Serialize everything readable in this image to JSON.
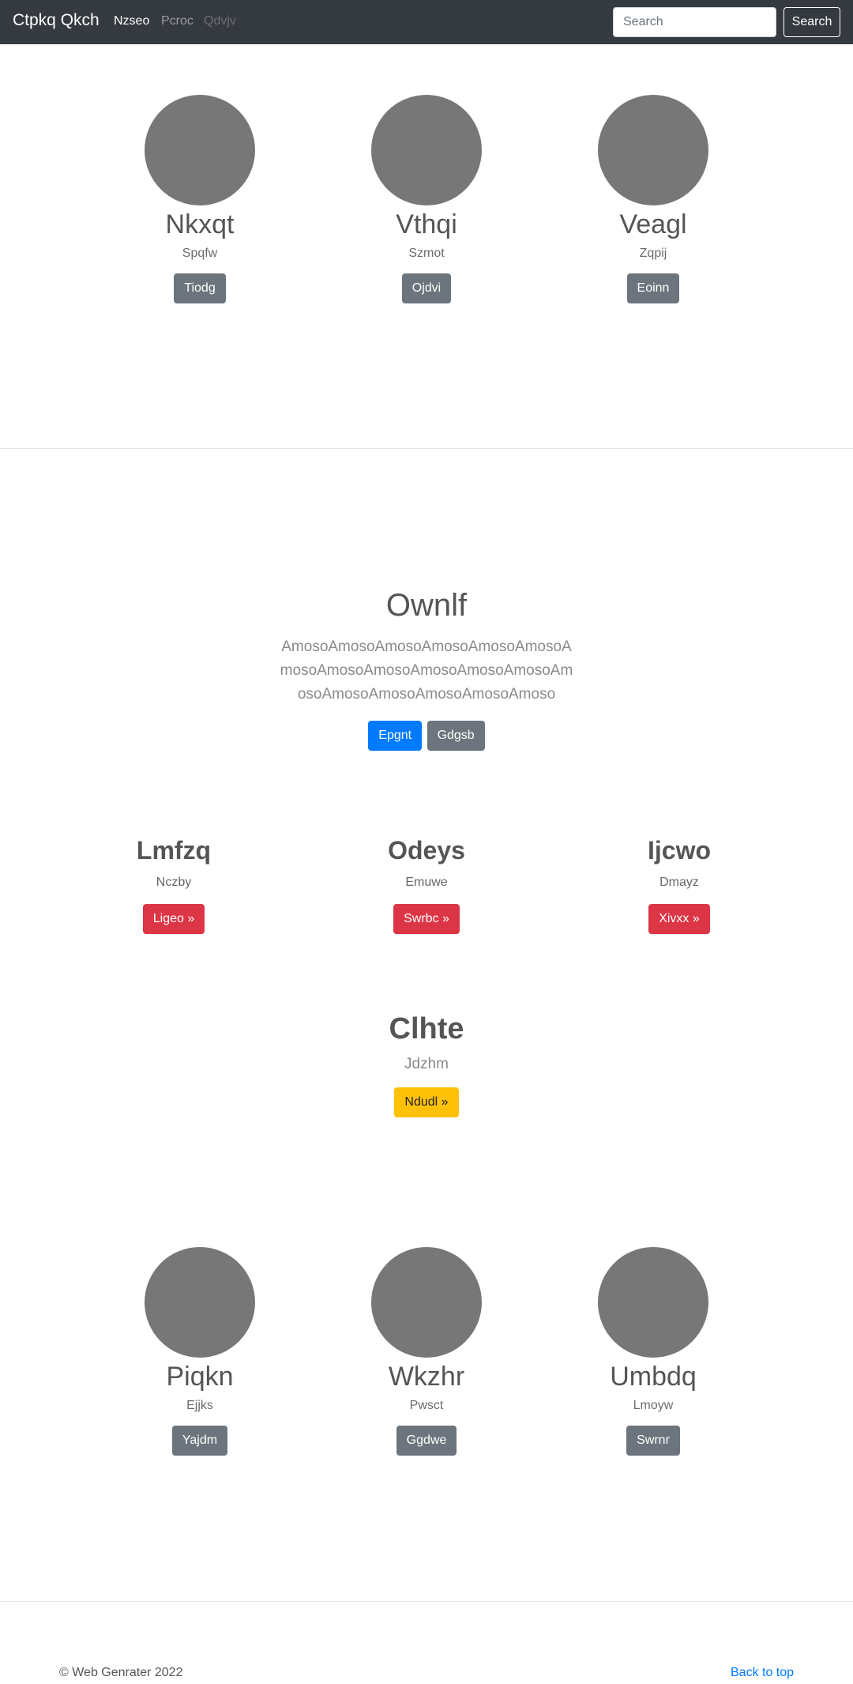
{
  "navbar": {
    "brand": "Ctpkq Qkch",
    "links": [
      {
        "label": "Nzseo",
        "state": "active"
      },
      {
        "label": "Pcroc",
        "state": "normal"
      },
      {
        "label": "Qdvjv",
        "state": "disabled"
      }
    ],
    "search_placeholder": "Search",
    "search_button": "Search"
  },
  "profiles_top": [
    {
      "name": "Nkxqt",
      "subtitle": "Spqfw",
      "button": "Tiodg"
    },
    {
      "name": "Vthqi",
      "subtitle": "Szmot",
      "button": "Ojdvi"
    },
    {
      "name": "Veagl",
      "subtitle": "Zqpij",
      "button": "Eoinn"
    }
  ],
  "hero": {
    "title": "Ownlf",
    "text": "AmosoAmosoAmosoAmosoAmosoAmosoAmosoAmosoAmosoAmosoAmosoAmosoAmosoAmosoAmosoAmosoAmosoAmoso",
    "primary_button": "Epgnt",
    "secondary_button": "Gdgsb"
  },
  "features": [
    {
      "title": "Lmfzq",
      "subtitle": "Nczby",
      "button": "Ligeo »"
    },
    {
      "title": "Odeys",
      "subtitle": "Emuwe",
      "button": "Swrbc »"
    },
    {
      "title": "Ijcwo",
      "subtitle": "Dmayz",
      "button": "Xivxx »"
    }
  ],
  "callout": {
    "title": "Clhte",
    "subtitle": "Jdzhm",
    "button": "Ndudl »"
  },
  "profiles_bottom": [
    {
      "name": "Piqkn",
      "subtitle": "Ejjks",
      "button": "Yajdm"
    },
    {
      "name": "Wkzhr",
      "subtitle": "Pwsct",
      "button": "Ggdwe"
    },
    {
      "name": "Umbdq",
      "subtitle": "Lmoyw",
      "button": "Swrnr"
    }
  ],
  "footer": {
    "copyright": "© Web Genrater 2022",
    "back_to_top": "Back to top"
  },
  "colors": {
    "navbar_bg": "#343a40",
    "avatar": "#777777",
    "primary": "#007bff",
    "secondary": "#6c757d",
    "danger": "#dc3545",
    "warning": "#ffc107"
  }
}
